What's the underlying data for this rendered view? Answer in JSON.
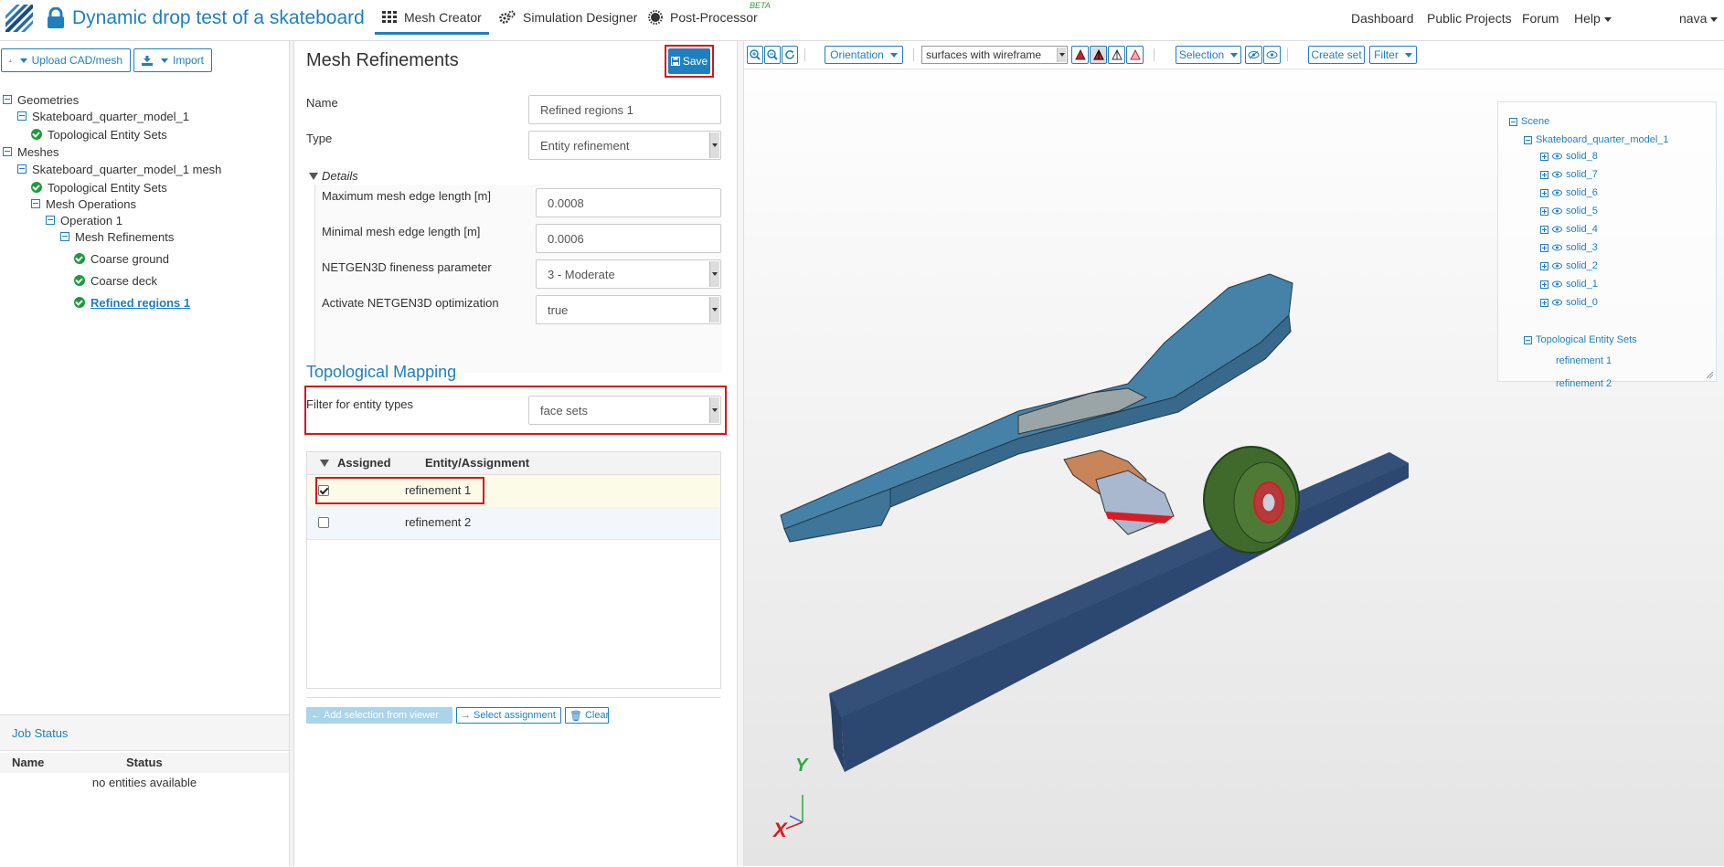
{
  "header": {
    "title": "Dynamic drop test of a skateboard",
    "tabs": [
      {
        "label": "Mesh Creator"
      },
      {
        "label": "Simulation Designer"
      },
      {
        "label": "Post-Processor"
      }
    ],
    "beta_badge": "BETA",
    "right_links": [
      "Dashboard",
      "Public Projects",
      "Forum",
      "Help",
      "nava"
    ]
  },
  "sidebar": {
    "upload_label": "Upload CAD/mesh",
    "import_label": "Import",
    "tree": {
      "geometries": "Geometries",
      "geometry_model": "Skateboard_quarter_model_1",
      "geometry_sets": "Topological Entity Sets",
      "meshes": "Meshes",
      "mesh_model": "Skateboard_quarter_model_1 mesh",
      "mesh_sets": "Topological Entity Sets",
      "mesh_operations": "Mesh Operations",
      "operation": "Operation 1",
      "refinements": "Mesh Refinements",
      "items": [
        "Coarse ground",
        "Coarse deck",
        "Refined regions 1"
      ]
    },
    "job_status": {
      "title": "Job Status",
      "col_name": "Name",
      "col_status": "Status",
      "empty": "no entities available"
    }
  },
  "panel": {
    "title": "Mesh Refinements",
    "save_label": "Save",
    "name_label": "Name",
    "name_value": "Refined regions 1",
    "type_label": "Type",
    "type_value": "Entity refinement",
    "details_label": "Details",
    "max_edge_label": "Maximum mesh edge length [m]",
    "max_edge_value": "0.0008",
    "min_edge_label": "Minimal mesh edge length [m]",
    "min_edge_value": "0.0006",
    "fineness_label": "NETGEN3D fineness parameter",
    "fineness_value": "3 - Moderate",
    "optimization_label": "Activate NETGEN3D optimization",
    "optimization_value": "true",
    "mapping_title": "Topological Mapping",
    "filter_label": "Filter for entity types",
    "filter_value": "face sets",
    "table": {
      "col_assigned": "Assigned",
      "col_entity": "Entity/Assignment",
      "rows": [
        {
          "name": "refinement 1",
          "checked": true
        },
        {
          "name": "refinement 2",
          "checked": false
        }
      ]
    },
    "buttons": {
      "add_selection": "Add selection from viewer",
      "select_assignment": "Select assignment",
      "clear": "Clear"
    }
  },
  "viewer": {
    "orientation_label": "Orientation",
    "render_mode": "surfaces with wireframe",
    "selection_label": "Selection",
    "create_set_label": "Create set",
    "filter_label": "Filter",
    "axis_labels": {
      "x": "X",
      "y": "Y"
    },
    "scene": {
      "root": "Scene",
      "model": "Skateboard_quarter_model_1",
      "solids": [
        "solid_8",
        "solid_7",
        "solid_6",
        "solid_5",
        "solid_4",
        "solid_3",
        "solid_2",
        "solid_1",
        "solid_0"
      ],
      "sets_label": "Topological Entity Sets",
      "sets": [
        "refinement 1",
        "refinement 2"
      ]
    }
  },
  "colors": {
    "accent": "#1f7fbf",
    "highlight": "#d9141c",
    "success": "#1e9a3c"
  }
}
